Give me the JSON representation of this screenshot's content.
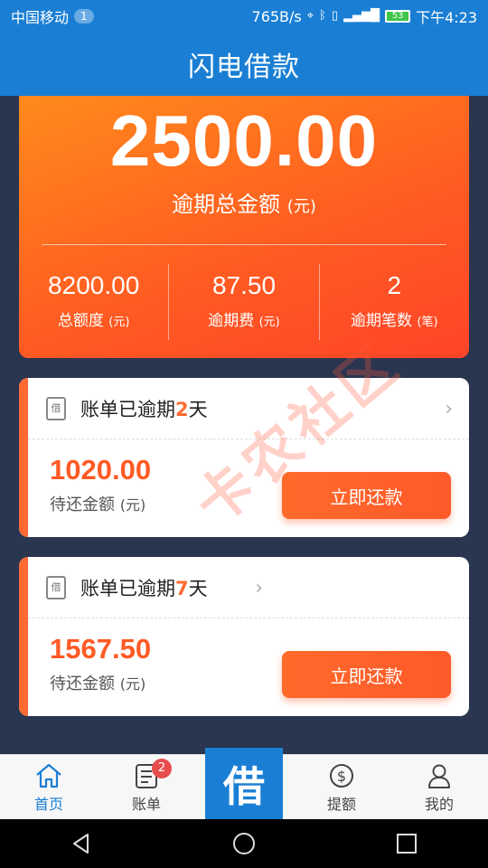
{
  "status_bar": {
    "carrier": "中国移动",
    "sim_badge": "1",
    "speed": "765B/s",
    "battery": "53",
    "time": "下午4:23"
  },
  "header": {
    "title": "闪电借款"
  },
  "summary": {
    "overdue_total": "2500.00",
    "overdue_total_label": "逾期总金额",
    "overdue_total_unit": "(元)",
    "stats": [
      {
        "value": "8200.00",
        "label": "总额度",
        "unit": "(元)"
      },
      {
        "value": "87.50",
        "label": "逾期费",
        "unit": "(元)"
      },
      {
        "value": "2",
        "label": "逾期笔数",
        "unit": "(笔)"
      }
    ]
  },
  "bills": [
    {
      "icon_text": "借",
      "title_prefix": "账单已逾期",
      "days": "2",
      "title_suffix": "天",
      "amount": "1020.00",
      "amount_label": "待还金额",
      "amount_unit": "(元)",
      "button": "立即还款"
    },
    {
      "icon_text": "借",
      "title_prefix": "账单已逾期",
      "days": "7",
      "title_suffix": "天",
      "amount": "1567.50",
      "amount_label": "待还金额",
      "amount_unit": "(元)",
      "button": "立即还款"
    }
  ],
  "watermark": "卡农社区",
  "tabbar": {
    "home": "首页",
    "bills": "账单",
    "bills_badge": "2",
    "center": "借",
    "withdraw": "提额",
    "mine": "我的"
  },
  "colors": {
    "primary": "#1a7fd4",
    "accent": "#ff6a33",
    "badge": "#e84d4d"
  }
}
